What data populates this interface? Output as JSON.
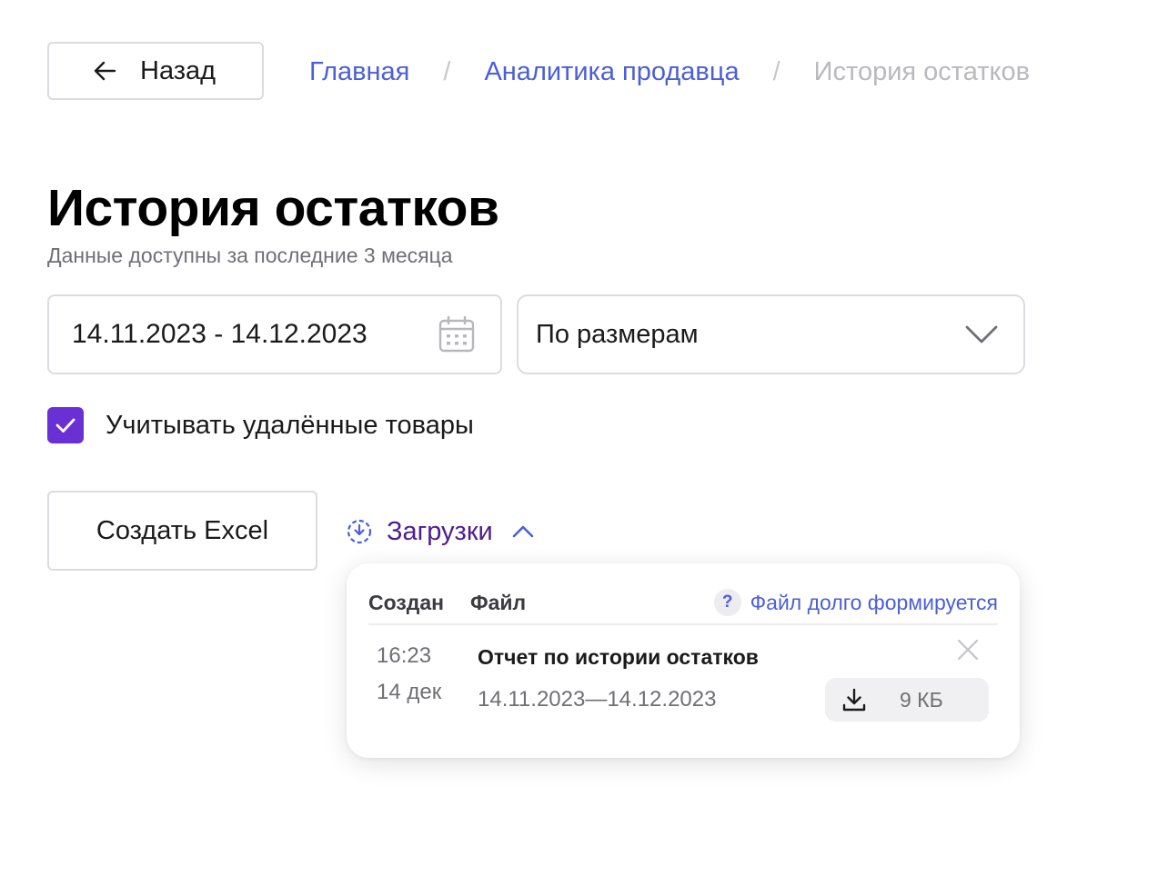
{
  "back_button": {
    "label": "Назад",
    "icon": "arrow-left-icon"
  },
  "breadcrumb": {
    "items": [
      {
        "label": "Главная",
        "link": true
      },
      {
        "label": "Аналитика продавца",
        "link": true
      },
      {
        "label": "История остатков",
        "link": false
      }
    ],
    "separator": "/"
  },
  "page": {
    "title": "История остатков",
    "subtitle": "Данные доступны за последние 3 месяца"
  },
  "filters": {
    "date_range": {
      "value": "14.11.2023 - 14.12.2023",
      "icon": "calendar-icon"
    },
    "grouping": {
      "value": "По размерам",
      "icon": "chevron-down-icon"
    },
    "include_deleted": {
      "label": "Учитывать удалённые товары",
      "checked": true
    }
  },
  "actions": {
    "create_excel_label": "Создать Excel",
    "downloads_label": "Загрузки",
    "downloads_expanded": true
  },
  "downloads_panel": {
    "col_created": "Создан",
    "col_file": "Файл",
    "help_badge": "?",
    "slow_file_link": "Файл долго формируется",
    "rows": [
      {
        "time": "16:23",
        "date": "14 дек",
        "name": "Отчет по истории остатков",
        "range": "14.11.2023—14.12.2023",
        "size": "9 КБ"
      }
    ]
  },
  "colors": {
    "link": "#4b5fd6",
    "accent_purple": "#6b2fd6",
    "downloads_text": "#4e1d8f",
    "muted_text": "#6f6f75",
    "border": "#dcdce0"
  }
}
